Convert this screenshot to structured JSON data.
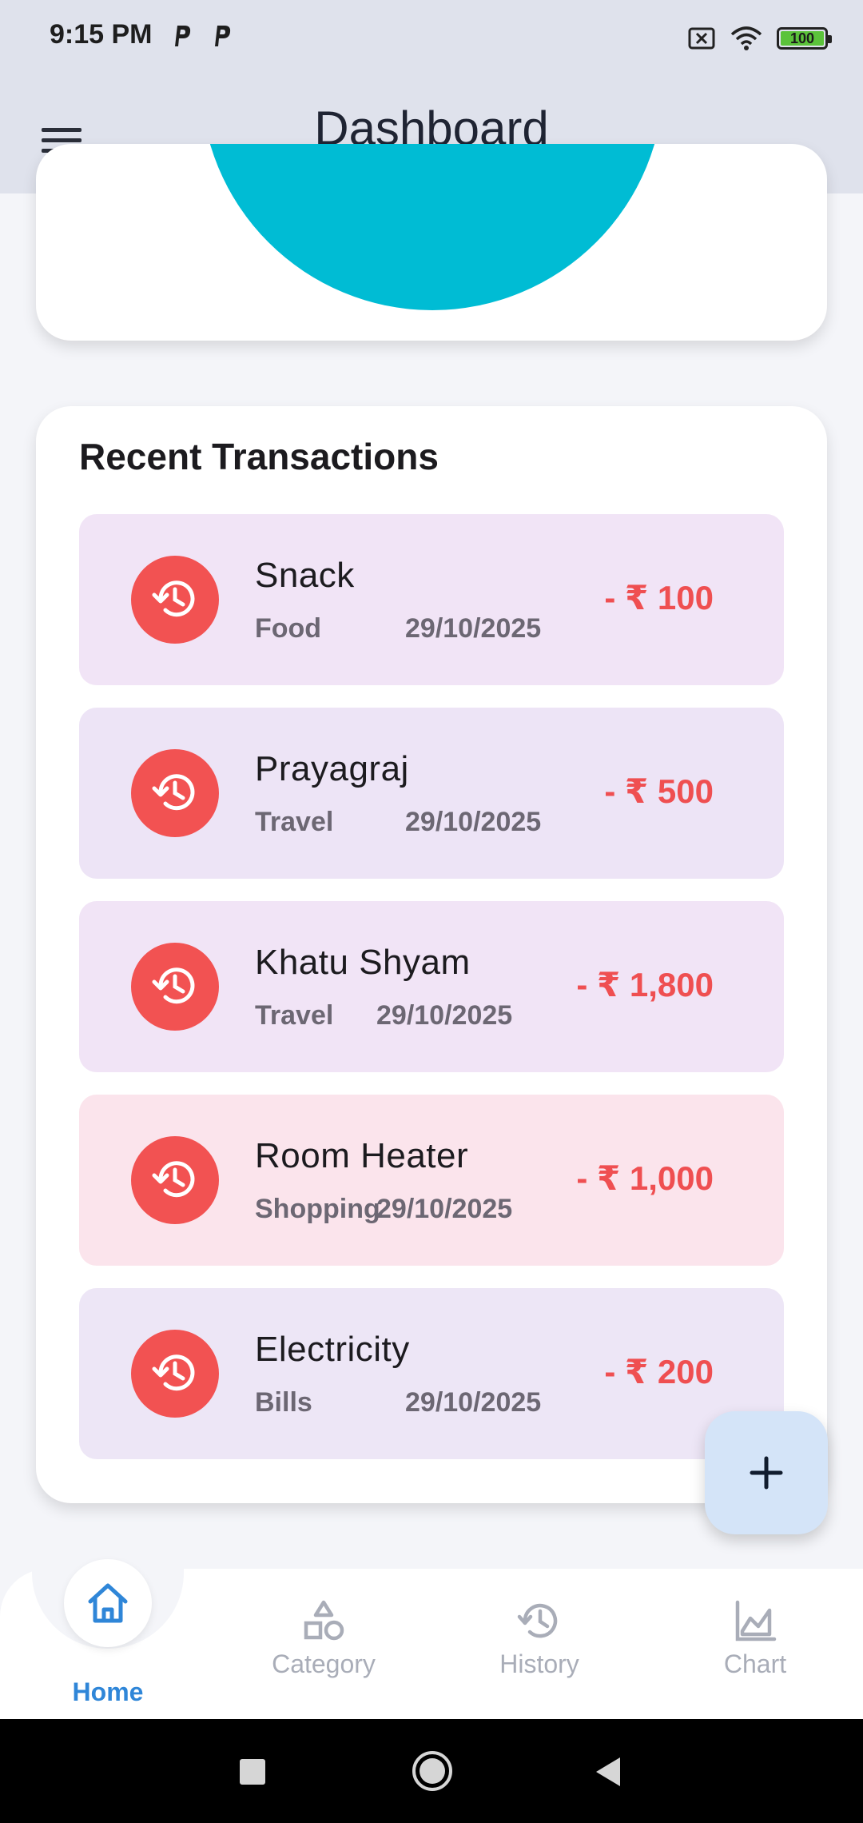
{
  "status_bar": {
    "time": "9:15 PM",
    "notification_icons": [
      "p-icon",
      "p-icon"
    ],
    "battery_level": "100",
    "icons": [
      "sim-x-icon",
      "wifi-icon",
      "battery-icon"
    ]
  },
  "app_bar": {
    "title": "Dashboard",
    "menu_icon": "menu-icon"
  },
  "pie_chart": {
    "color": "#00bcd4"
  },
  "recent": {
    "heading": "Recent Transactions",
    "items": [
      {
        "name": "Snack",
        "category": "Food",
        "date": "29/10/2025",
        "amount": "- ₹ 100",
        "bg": "#f1e4f6"
      },
      {
        "name": "Prayagraj",
        "category": "Travel",
        "date": "29/10/2025",
        "amount": "- ₹ 500",
        "bg": "#ede4f6"
      },
      {
        "name": "Khatu Shyam",
        "category": "Travel",
        "date": "29/10/2025",
        "amount": "- ₹ 1,800",
        "bg": "#f1e4f6"
      },
      {
        "name": "Room Heater",
        "category": "Shopping",
        "date": "29/10/2025",
        "amount": "- ₹ 1,000",
        "bg": "#fbe4ec"
      },
      {
        "name": "Electricity",
        "category": "Bills",
        "date": "29/10/2025",
        "amount": "- ₹ 200",
        "bg": "#ede6f6"
      }
    ],
    "item_icon": "history-icon",
    "amount_color": "#ef4f51",
    "icon_color": "#f25252"
  },
  "fab": {
    "icon": "plus-icon"
  },
  "bottom_nav": {
    "items": [
      {
        "label": "Home",
        "icon": "home-icon",
        "active": true
      },
      {
        "label": "Category",
        "icon": "category-icon",
        "active": false
      },
      {
        "label": "History",
        "icon": "history-icon",
        "active": false
      },
      {
        "label": "Chart",
        "icon": "chart-icon",
        "active": false
      }
    ],
    "active_color": "#2f86d8",
    "inactive_color": "#a9adb8"
  },
  "system_nav": {
    "icons": [
      "recents-icon",
      "home-circle-icon",
      "back-icon"
    ]
  }
}
